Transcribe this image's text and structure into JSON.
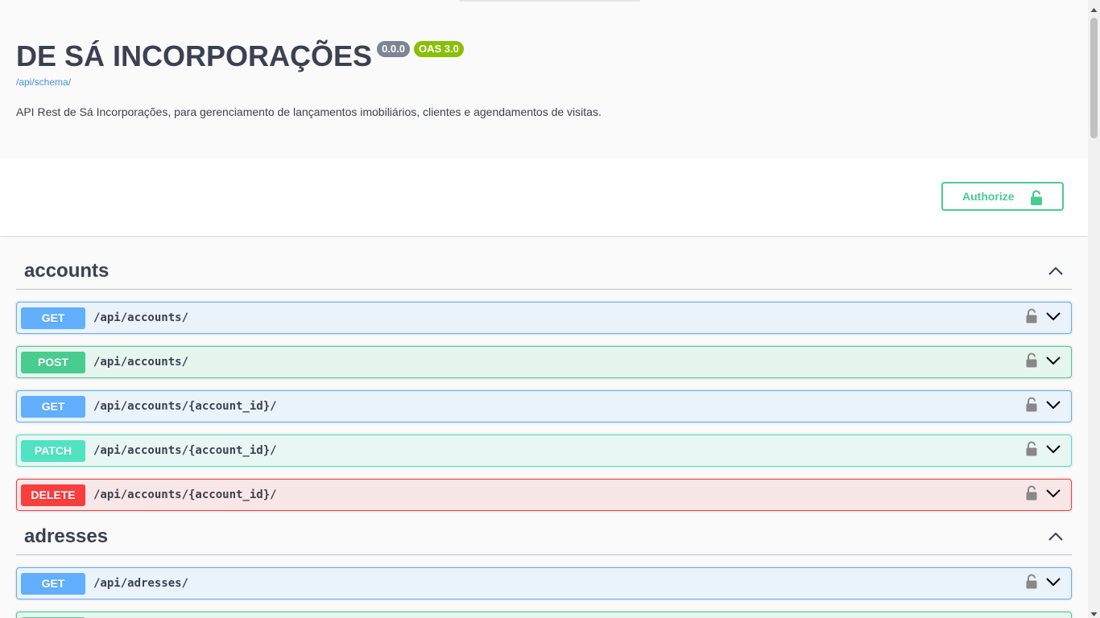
{
  "info": {
    "title": "DE SÁ INCORPORAÇÕES",
    "version": "0.0.0",
    "oas_badge": "OAS 3.0",
    "schema_link": "/api/schema/",
    "description": "API Rest de Sá Incorporações, para gerenciamento de lançamentos imobiliários, clientes e agendamentos de visitas."
  },
  "authorize": {
    "label": "Authorize",
    "icon": "unlock-icon"
  },
  "colors": {
    "get": "#61affe",
    "post": "#49cc90",
    "patch": "#50e3c2",
    "delete": "#f93e3e",
    "text": "#3b4151"
  },
  "tags": [
    {
      "name": "accounts",
      "operations": [
        {
          "method": "GET",
          "path": "/api/accounts/"
        },
        {
          "method": "POST",
          "path": "/api/accounts/"
        },
        {
          "method": "GET",
          "path": "/api/accounts/{account_id}/"
        },
        {
          "method": "PATCH",
          "path": "/api/accounts/{account_id}/"
        },
        {
          "method": "DELETE",
          "path": "/api/accounts/{account_id}/"
        }
      ]
    },
    {
      "name": "adresses",
      "operations": [
        {
          "method": "GET",
          "path": "/api/adresses/"
        }
      ]
    }
  ]
}
